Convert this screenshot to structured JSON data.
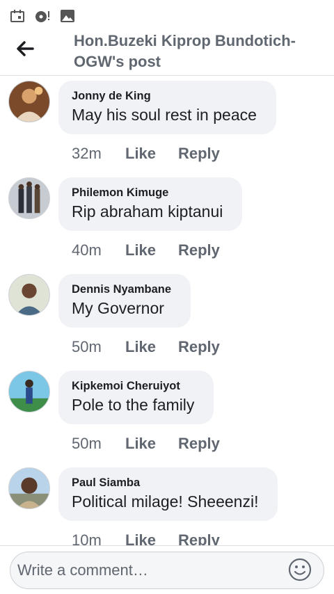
{
  "status_bar": {
    "icons": [
      "calendar-icon",
      "music-disc-icon",
      "image-icon"
    ]
  },
  "header": {
    "back_icon": "arrow-left-icon",
    "title": "Hon.Buzeki Kiprop Bundotich-OGW's post"
  },
  "comments": [
    {
      "author": "Jonny de King",
      "text": "May his soul rest in peace",
      "time": "32m",
      "like_label": "Like",
      "reply_label": "Reply"
    },
    {
      "author": "Philemon Kimuge",
      "text": "Rip abraham kiptanui",
      "time": "40m",
      "like_label": "Like",
      "reply_label": "Reply"
    },
    {
      "author": "Dennis Nyambane",
      "text": "My Governor",
      "time": "50m",
      "like_label": "Like",
      "reply_label": "Reply"
    },
    {
      "author": "Kipkemoi Cheruiyot",
      "text": "Pole to the family",
      "time": "50m",
      "like_label": "Like",
      "reply_label": "Reply"
    },
    {
      "author": "Paul Siamba",
      "text": "Political milage! Sheeenzi!",
      "time": "10m",
      "like_label": "Like",
      "reply_label": "Reply"
    }
  ],
  "composer": {
    "placeholder": "Write a comment…",
    "emoji_icon": "smiley-icon"
  },
  "colors": {
    "bubble": "#f0f2f5",
    "secondary_text": "#606770",
    "primary_text": "#1c1e21"
  }
}
